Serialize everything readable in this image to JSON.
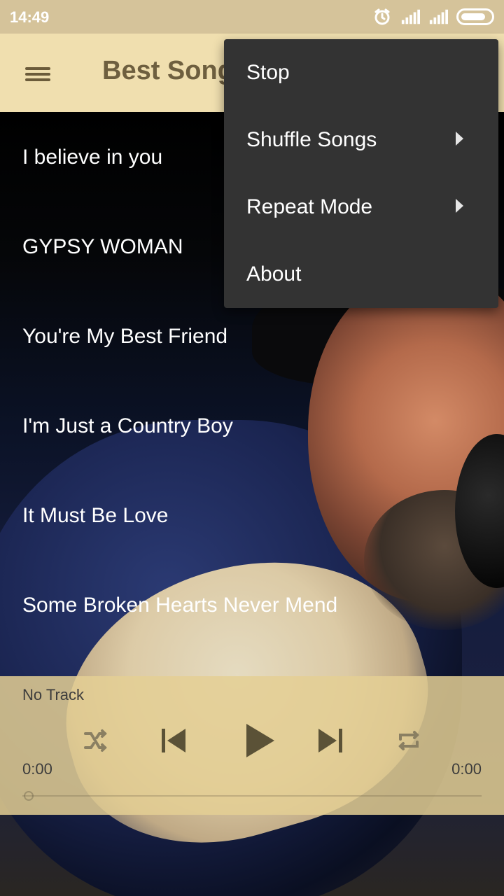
{
  "status_bar": {
    "time": "14:49",
    "icons": [
      "alarm-icon",
      "signal-icon",
      "signal-icon",
      "battery-icon"
    ]
  },
  "app_bar": {
    "title": "Best Songs"
  },
  "songs": [
    {
      "title": "I believe in you"
    },
    {
      "title": "GYPSY WOMAN"
    },
    {
      "title": "You're My Best Friend"
    },
    {
      "title": "I'm Just a Country Boy"
    },
    {
      "title": "It Must Be Love"
    },
    {
      "title": "Some Broken Hearts Never Mend"
    }
  ],
  "player": {
    "now_playing": "No Track",
    "elapsed": "0:00",
    "duration": "0:00",
    "progress": 0,
    "controls": [
      "shuffle-icon",
      "previous-icon",
      "play-icon",
      "next-icon",
      "repeat-icon"
    ]
  },
  "menu": {
    "items": [
      {
        "label": "Stop",
        "has_submenu": false
      },
      {
        "label": "Shuffle Songs",
        "has_submenu": true
      },
      {
        "label": "Repeat Mode",
        "has_submenu": true
      },
      {
        "label": "About",
        "has_submenu": false
      }
    ]
  },
  "colors": {
    "status_bar": "#d5c39a",
    "app_bar": "#f0dfaf",
    "title_text": "#6e5f3f",
    "player_panel": "#e4cf94",
    "menu_bg": "#333333"
  }
}
